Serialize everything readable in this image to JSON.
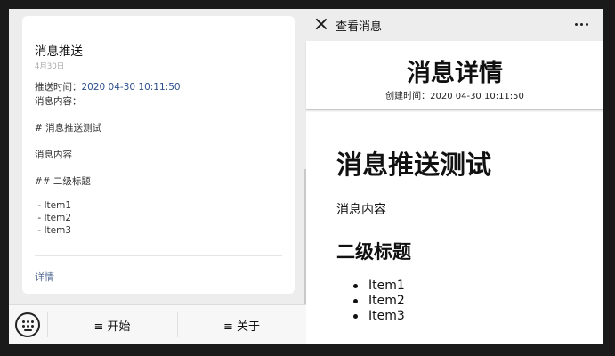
{
  "left_card": {
    "title": "消息推送",
    "date": "4月30日",
    "push_time_label": "推送时间：",
    "push_time_value": "2020 04-30 10:11:50",
    "content_label": "消息内容：",
    "lines": [
      "# 消息推送测试",
      "消息内容",
      "## 二级标题",
      " - Item1",
      " - Item2",
      " - Item3"
    ],
    "details_link": "详情"
  },
  "bottom_menu": {
    "keyboard_icon": "keyboard-icon",
    "items": [
      {
        "label": "≡ 开始"
      },
      {
        "label": "≡ 关于"
      }
    ]
  },
  "detail_page": {
    "topbar_title": "查看消息",
    "title": "消息详情",
    "created": "创建时间：2020 04-30 10:11:50",
    "content": {
      "h1": "消息推送测试",
      "p": "消息内容",
      "h2": "二级标题",
      "items": [
        "Item1",
        "Item2",
        "Item3"
      ]
    }
  }
}
